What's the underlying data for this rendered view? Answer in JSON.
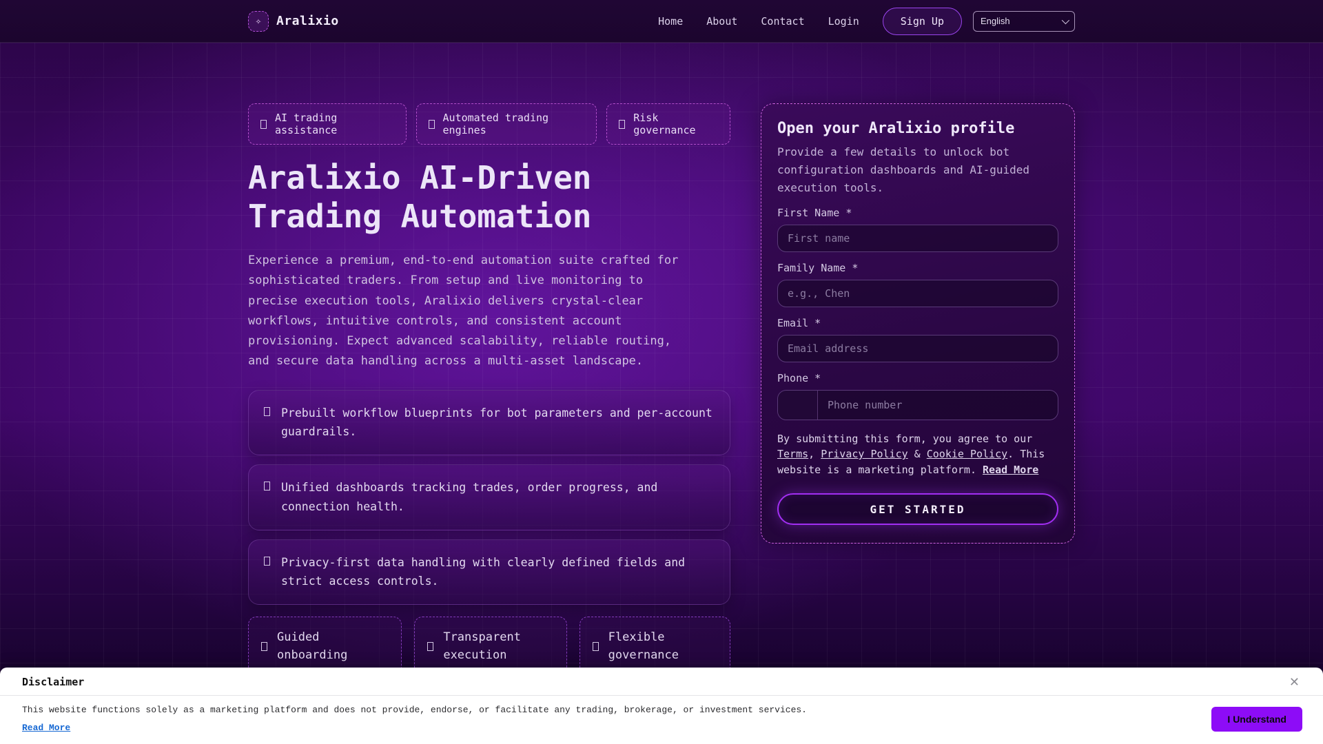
{
  "brand": {
    "name": "Aralixio"
  },
  "icons": {
    "logo": "✧",
    "close": "✕",
    "chevron_down": "v",
    "feature_glyph": "placeholder-box"
  },
  "colors": {
    "accent": "#a855f7",
    "badge_border": "#cf63df",
    "cta_border": "#a22ef2",
    "accept_bg": "#8d0cf7",
    "link_blue": "#1668d3"
  },
  "nav": {
    "links": [
      {
        "label": "Home"
      },
      {
        "label": "About"
      },
      {
        "label": "Contact"
      },
      {
        "label": "Login"
      }
    ],
    "signup": "Sign Up",
    "language": "English"
  },
  "hero": {
    "badges": [
      {
        "label": "AI trading assistance"
      },
      {
        "label": "Automated trading engines"
      },
      {
        "label": "Risk governance"
      }
    ],
    "title_line1": "Aralixio AI-Driven",
    "title_line2": "Trading Automation",
    "description": "Experience a premium, end-to-end automation suite crafted for sophisticated traders. From setup and live monitoring to precise execution tools, Aralixio delivers crystal-clear workflows, intuitive controls, and consistent account provisioning. Expect advanced scalability, reliable routing, and secure data handling across a multi-asset landscape.",
    "features": [
      {
        "text": "Prebuilt workflow blueprints for bot parameters and per-account guardrails."
      },
      {
        "text": "Unified dashboards tracking trades, order progress, and connection health."
      },
      {
        "text": "Privacy-first data handling with clearly defined fields and strict access controls."
      }
    ],
    "chips": [
      {
        "label": "Guided onboarding"
      },
      {
        "label": "Transparent execution"
      },
      {
        "label": "Flexible governance"
      }
    ]
  },
  "form": {
    "title": "Open your Aralixio profile",
    "subtitle": "Provide a few details to unlock bot configuration dashboards and AI-guided execution tools.",
    "first_name": {
      "label": "First Name *",
      "placeholder": "First name"
    },
    "family_name": {
      "label": "Family Name *",
      "placeholder": "e.g., Chen"
    },
    "email": {
      "label": "Email *",
      "placeholder": "Email address"
    },
    "phone": {
      "label": "Phone *",
      "placeholder": "Phone number"
    },
    "terms": {
      "part1": "By submitting this form, you agree to our ",
      "link_terms": "Terms",
      "part2": ", ",
      "link_privacy": "Privacy Policy",
      "part3": " & ",
      "link_cookie": "Cookie Policy",
      "part4": ". This website is a marketing platform. ",
      "link_read_more": "Read More"
    },
    "submit": "GET STARTED"
  },
  "disclaimer": {
    "title": "Disclaimer",
    "body": "This website functions solely as a marketing platform and does not provide, endorse, or facilitate any trading, brokerage, or investment services.",
    "read_more": "Read More",
    "accept": "I Understand"
  }
}
